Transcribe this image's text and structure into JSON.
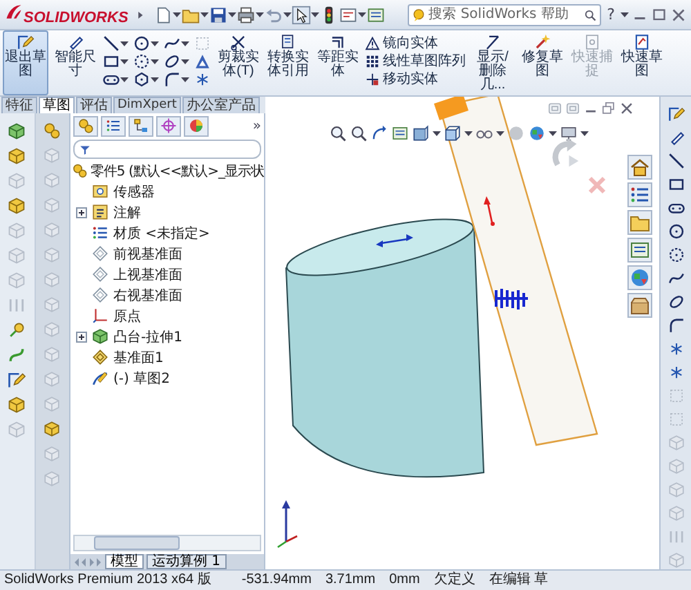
{
  "title_bar": {
    "logo": "SOLIDWORKS",
    "search": {
      "placeholder": "搜索 SolidWorks 帮助"
    },
    "help": "?"
  },
  "ribbon": [
    {
      "kind": "large",
      "label": "退出草图",
      "pressed": true,
      "disabled": false
    },
    {
      "kind": "large",
      "label": "智能尺寸",
      "pressed": false,
      "disabled": false
    },
    {
      "kind": "tools"
    },
    {
      "kind": "large",
      "label": "剪裁实体(T)",
      "pressed": false,
      "disabled": false
    },
    {
      "kind": "large",
      "label": "转换实体引用",
      "pressed": false,
      "disabled": false
    },
    {
      "kind": "large",
      "label": "等距实体",
      "pressed": false,
      "disabled": false
    },
    {
      "kind": "stack",
      "items": [
        "镜向实体",
        "线性草图阵列",
        "移动实体"
      ]
    },
    {
      "kind": "large",
      "label": "显示/删除几...",
      "pressed": false,
      "disabled": false
    },
    {
      "kind": "large",
      "label": "修复草图",
      "pressed": false,
      "disabled": false
    },
    {
      "kind": "large",
      "label": "快速捕捉",
      "pressed": false,
      "disabled": true
    },
    {
      "kind": "large",
      "label": "快速草图",
      "pressed": false,
      "disabled": false
    }
  ],
  "tabs": [
    {
      "label": "特征",
      "selected": false
    },
    {
      "label": "草图",
      "selected": true
    },
    {
      "label": "评估",
      "selected": false
    },
    {
      "label": "DimXpert",
      "selected": false
    },
    {
      "label": "办公室产品",
      "selected": false
    }
  ],
  "feature_tree": {
    "more": "»",
    "root": "零件5 (默认<<默认>_显示状",
    "items": [
      {
        "label": "传感器",
        "kind": "sensor",
        "expandable": false
      },
      {
        "label": "注解",
        "kind": "annotation",
        "expandable": true
      },
      {
        "label": "材质 <未指定>",
        "kind": "material",
        "expandable": false
      },
      {
        "label": "前视基准面",
        "kind": "plane",
        "expandable": false
      },
      {
        "label": "上视基准面",
        "kind": "plane",
        "expandable": false
      },
      {
        "label": "右视基准面",
        "kind": "plane",
        "expandable": false
      },
      {
        "label": "原点",
        "kind": "origin",
        "expandable": false
      },
      {
        "label": "凸台-拉伸1",
        "kind": "feature",
        "expandable": true
      },
      {
        "label": "基准面1",
        "kind": "ref_plane",
        "expandable": false
      },
      {
        "label": "(-) 草图2",
        "kind": "sketch",
        "expandable": false
      }
    ]
  },
  "bottom_tabs": [
    {
      "label": "模型",
      "selected": true
    },
    {
      "label": "运动算例 1",
      "selected": false
    }
  ],
  "status_bar": [
    "SolidWorks Premium 2013 x64 版",
    "-531.94mm",
    "3.71mm",
    "0mm",
    "欠定义",
    "在编辑 草"
  ]
}
